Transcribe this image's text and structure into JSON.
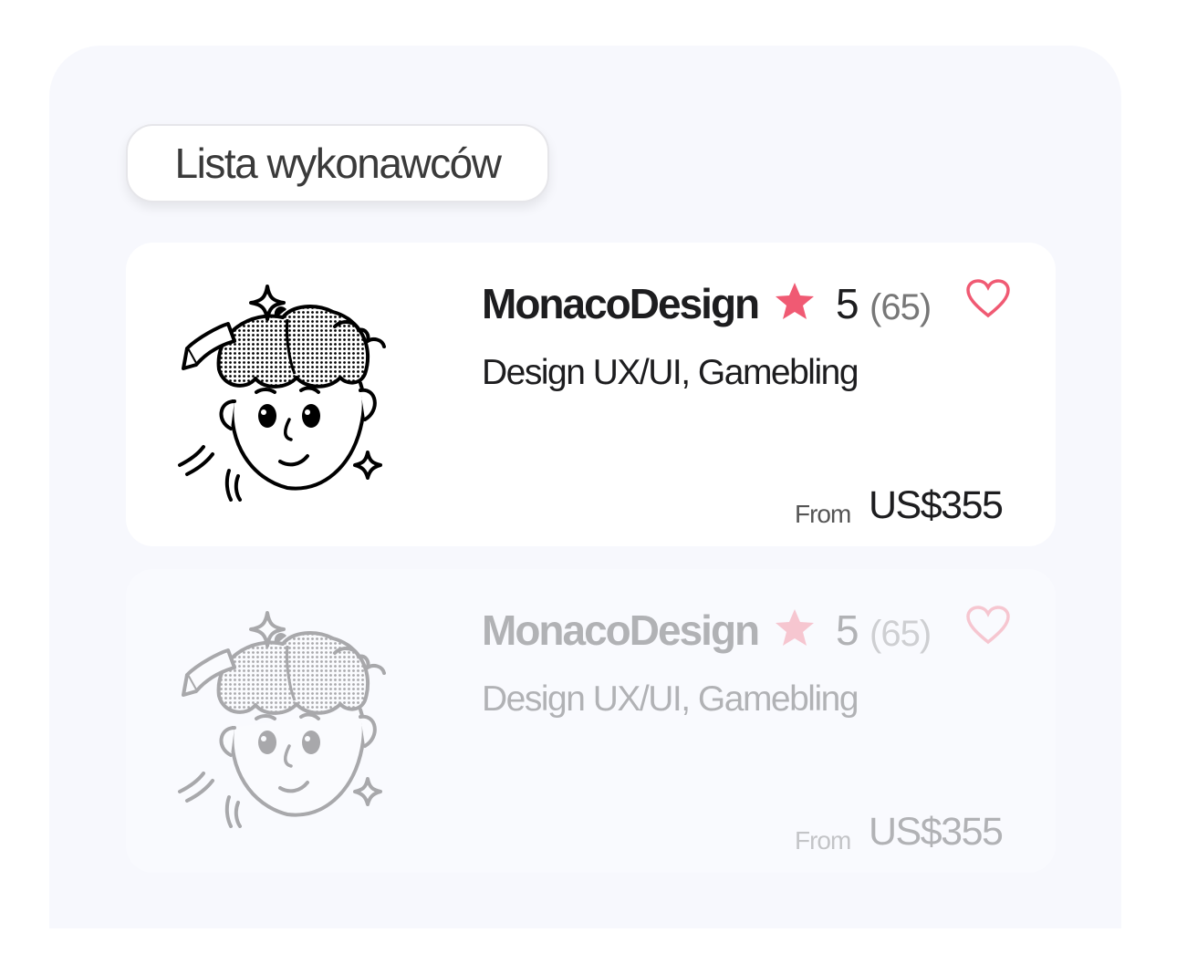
{
  "header": {
    "title": "Lista wykonawców"
  },
  "colors": {
    "accent": "#f05a73",
    "panel_bg": "#f7f8fd",
    "card_bg": "#ffffff",
    "text": "#1d1d1f"
  },
  "contractors": [
    {
      "name": "MonacoDesign",
      "rating": "5",
      "reviews": "(65)",
      "skills": "Design UX/UI, Gamebling",
      "price_prefix": "From",
      "price": "US$355",
      "icons": {
        "star": "star-icon",
        "heart": "heart-icon",
        "avatar": "avatar-illustration"
      },
      "state": "active"
    },
    {
      "name": "MonacoDesign",
      "rating": "5",
      "reviews": "(65)",
      "skills": "Design UX/UI, Gamebling",
      "price_prefix": "From",
      "price": "US$355",
      "icons": {
        "star": "star-icon",
        "heart": "heart-icon",
        "avatar": "avatar-illustration"
      },
      "state": "faded"
    }
  ]
}
